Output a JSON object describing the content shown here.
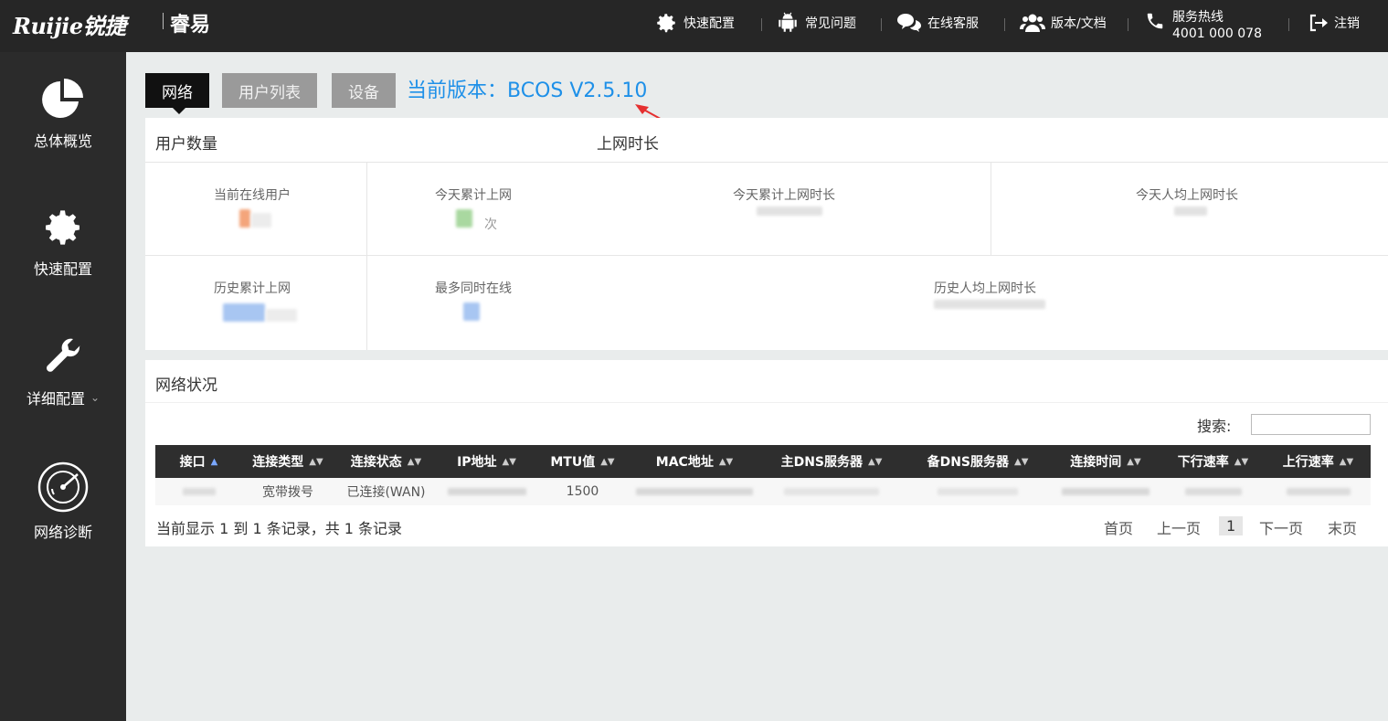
{
  "header": {
    "logo": "Ruijie锐捷",
    "logo_sub": "睿易",
    "nav": [
      {
        "label": "快速配置",
        "icon": "gear-icon"
      },
      {
        "label": "常见问题",
        "icon": "android-icon"
      },
      {
        "label": "在线客服",
        "icon": "chat-icon"
      },
      {
        "label": "版本/文档",
        "icon": "users-icon"
      }
    ],
    "hotline_label": "服务热线",
    "hotline_number": "4001 000 078",
    "logout": "注销"
  },
  "sidebar": {
    "items": [
      {
        "label": "总体概览",
        "icon": "pie-chart-icon"
      },
      {
        "label": "快速配置",
        "icon": "gear-icon"
      },
      {
        "label": "详细配置",
        "icon": "wrench-icon"
      },
      {
        "label": "网络诊断",
        "icon": "radar-icon"
      }
    ]
  },
  "tabs": [
    "网络",
    "用户列表",
    "设备"
  ],
  "version_text": "当前版本：BCOS V2.5.10",
  "users_card": {
    "head_users": "用户数量",
    "head_online_time": "上网时长",
    "stats": {
      "current_online": "当前在线用户",
      "today_access": "今天累计上网",
      "today_access_unit": "次",
      "today_duration": "今天累计上网时长",
      "today_avg": "今天人均上网时长",
      "history_access": "历史累计上网",
      "max_online": "最多同时在线",
      "history_avg": "历史人均上网时长"
    }
  },
  "network_card": {
    "title": "网络状况",
    "search_label": "搜索:",
    "search_value": "",
    "columns": [
      "接口",
      "连接类型",
      "连接状态",
      "IP地址",
      "MTU值",
      "MAC地址",
      "主DNS服务器",
      "备DNS服务器",
      "连接时间",
      "下行速率",
      "上行速率"
    ],
    "row": {
      "type": "宽带拨号",
      "status": "已连接(WAN)",
      "mtu": "1500"
    },
    "footer": "当前显示 1 到 1 条记录，共 1 条记录",
    "pager": {
      "first": "首页",
      "prev": "上一页",
      "current": "1",
      "next": "下一页",
      "last": "末页"
    }
  },
  "colors": {
    "accent": "#1e90e8",
    "topbar": "#262626",
    "sidebar": "#2b2b2b"
  }
}
